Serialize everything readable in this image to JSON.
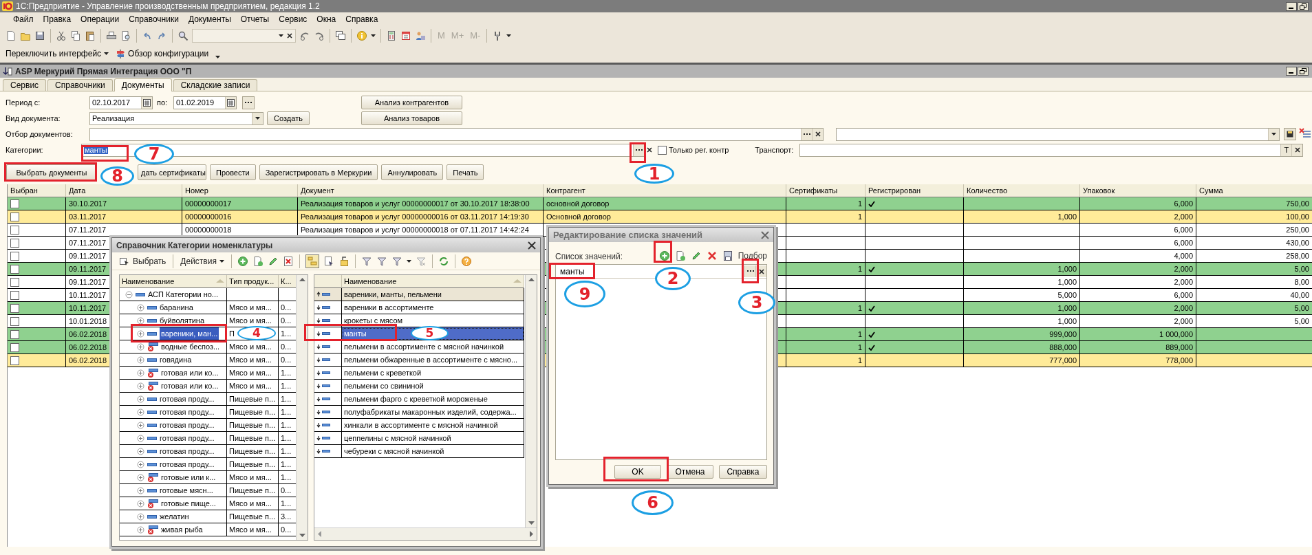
{
  "app": {
    "title": "1С:Предприятие - Управление производственным предприятием, редакция 1.2"
  },
  "menu": [
    "Файл",
    "Правка",
    "Операции",
    "Справочники",
    "Документы",
    "Отчеты",
    "Сервис",
    "Окна",
    "Справка"
  ],
  "toolbar": {
    "memory_buttons": [
      {
        "label": "M",
        "disabled": true
      },
      {
        "label": "M+",
        "disabled": true
      },
      {
        "label": "M-",
        "disabled": true
      }
    ]
  },
  "toolbar2": [
    {
      "label": "Переключить интерфейс",
      "kind": "dropdown"
    },
    {
      "label": "Обзор конфигурации",
      "kind": "link"
    }
  ],
  "document_window": {
    "title": "ASP Меркурий Прямая Интеграция ООО \"П",
    "tabs": [
      {
        "label": "Сервис",
        "selected": false
      },
      {
        "label": "Справочники",
        "selected": false
      },
      {
        "label": "Документы",
        "selected": true
      },
      {
        "label": "Складские записи",
        "selected": false
      }
    ],
    "period": {
      "label": "Период с:",
      "from": "02.10.2017",
      "to_label": "по:",
      "to": "01.02.2019"
    },
    "document_type": {
      "label": "Вид документа:",
      "value": "Реализация",
      "create_button": "Создать"
    },
    "analysis_buttons": [
      "Анализ контрагентов",
      "Анализ товаров"
    ],
    "document_filter": {
      "label": "Отбор документов:"
    },
    "categories": {
      "label": "Категории:",
      "value": "манты",
      "value_highlighted": true
    },
    "registered_only": {
      "label": "Только рег. контр",
      "checked": false
    },
    "transport": {
      "label": "Транспорт:",
      "type_button": "T"
    },
    "actions": [
      "Выбрать документы",
      "дать сертификаты",
      "Провести",
      "Зарегистрировать в Меркурии",
      "Аннулировать",
      "Печать"
    ],
    "table": {
      "columns": [
        "Выбран",
        "Дата",
        "Номер",
        "Документ",
        "Контрагент",
        "Сертификаты",
        "Регистрирован",
        "Количество",
        "Упаковок",
        "Сумма"
      ],
      "rows": [
        {
          "checked": false,
          "date": "30.10.2017",
          "number": "00000000017",
          "document": "Реализация товаров и услуг 00000000017 от 30.10.2017 18:38:00",
          "counterparty": "основной договор",
          "certificates": "1",
          "registered": true,
          "packages": "6,000",
          "sum": "750,00",
          "color": "#8fd18f"
        },
        {
          "checked": false,
          "date": "03.11.2017",
          "number": "00000000016",
          "document": "Реализация товаров и услуг 00000000016 от 03.11.2017 14:19:30",
          "counterparty": "Основной договор",
          "certificates": "1",
          "registered": false,
          "quantity": "1,000",
          "packages": "2,000",
          "sum": "100,00",
          "color": "#ffeb99"
        },
        {
          "checked": false,
          "date": "07.11.2017",
          "number": "00000000018",
          "document": "Реализация товаров и услуг 00000000018 от 07.11.2017 14:42:24",
          "registered": false,
          "packages": "6,000",
          "sum": "250,00",
          "color": "#ffffff"
        },
        {
          "checked": false,
          "date": "07.11.2017",
          "registered": false,
          "packages": "6,000",
          "sum": "430,00",
          "color": "#ffffff"
        },
        {
          "checked": false,
          "date": "09.11.2017",
          "registered": false,
          "packages": "4,000",
          "sum": "258,00",
          "color": "#ffffff"
        },
        {
          "checked": false,
          "date": "09.11.2017",
          "certificates": "1",
          "registered": true,
          "quantity": "1,000",
          "packages": "2,000",
          "sum": "5,00",
          "color": "#8fd18f"
        },
        {
          "checked": false,
          "date": "09.11.2017",
          "registered": false,
          "quantity": "1,000",
          "packages": "2,000",
          "sum": "8,00",
          "color": "#ffffff"
        },
        {
          "checked": false,
          "date": "10.11.2017",
          "registered": false,
          "quantity": "5,000",
          "packages": "6,000",
          "sum": "40,00",
          "color": "#ffffff"
        },
        {
          "checked": false,
          "date": "10.11.2017",
          "certificates": "1",
          "registered": true,
          "quantity": "1,000",
          "packages": "2,000",
          "sum": "5,00",
          "color": "#8fd18f"
        },
        {
          "checked": false,
          "date": "10.01.2018",
          "registered": false,
          "quantity": "1,000",
          "packages": "2,000",
          "sum": "5,00",
          "color": "#ffffff"
        },
        {
          "checked": false,
          "date": "06.02.2018",
          "certificates": "1",
          "registered": true,
          "quantity": "999,000",
          "packages": "1 000,000",
          "color": "#8fd18f"
        },
        {
          "checked": false,
          "date": "06.02.2018",
          "certificates": "1",
          "registered": true,
          "quantity": "888,000",
          "packages": "889,000",
          "color": "#8fd18f"
        },
        {
          "checked": false,
          "date": "06.02.2018",
          "certificates": "1",
          "registered": false,
          "quantity": "777,000",
          "packages": "778,000",
          "color": "#ffeb99"
        }
      ]
    }
  },
  "catalog_dialog": {
    "title": "Справочник Категории номенклатуры",
    "toolbar": [
      "Выбрать",
      "Действия"
    ],
    "tree": {
      "columns": [
        "Наименование",
        "Тип продук...",
        "К..."
      ],
      "items": [
        {
          "name": "АСП Категории но...",
          "expanded": true,
          "selected": false,
          "children": [
            {
              "name": "баранина",
              "type": "Мясо и мя...",
              "column_3": "0...",
              "deleted": false,
              "expanded": false,
              "selected": false
            },
            {
              "name": "буйволятина",
              "type": "Мясо и мя...",
              "column_3": "0...",
              "deleted": false,
              "expanded": false,
              "selected": false
            },
            {
              "name": "вареники, ман...",
              "type": "П",
              "column_3": "1...",
              "deleted": false,
              "expanded": false,
              "selected": true
            },
            {
              "name": "водные беспоз...",
              "type": "Мясо и мя...",
              "column_3": "0...",
              "deleted": true,
              "expanded": false,
              "selected": false
            },
            {
              "name": "говядина",
              "type": "Мясо и мя...",
              "column_3": "0...",
              "deleted": false,
              "expanded": false,
              "selected": false
            },
            {
              "name": "готовая или ко...",
              "type": "Мясо и мя...",
              "column_3": "1...",
              "deleted": true,
              "expanded": false,
              "selected": false
            },
            {
              "name": "готовая или ко...",
              "type": "Мясо и мя...",
              "column_3": "1...",
              "deleted": true,
              "expanded": false,
              "selected": false
            },
            {
              "name": "готовая проду...",
              "type": "Пищевые п...",
              "column_3": "1...",
              "deleted": false,
              "expanded": false,
              "selected": false
            },
            {
              "name": "готовая проду...",
              "type": "Пищевые п...",
              "column_3": "1...",
              "deleted": false,
              "expanded": false,
              "selected": false
            },
            {
              "name": "готовая проду...",
              "type": "Пищевые п...",
              "column_3": "1...",
              "deleted": false,
              "expanded": false,
              "selected": false
            },
            {
              "name": "готовая проду...",
              "type": "Пищевые п...",
              "column_3": "1...",
              "deleted": false,
              "expanded": false,
              "selected": false
            },
            {
              "name": "готовая проду...",
              "type": "Пищевые п...",
              "column_3": "1...",
              "deleted": false,
              "expanded": false,
              "selected": false
            },
            {
              "name": "готовая проду...",
              "type": "Пищевые п...",
              "column_3": "1...",
              "deleted": false,
              "expanded": false,
              "selected": false
            },
            {
              "name": "готовые или к...",
              "type": "Мясо и мя...",
              "column_3": "1...",
              "deleted": true,
              "expanded": false,
              "selected": false
            },
            {
              "name": "готовые мясн...",
              "type": "Пищевые п...",
              "column_3": "0...",
              "deleted": false,
              "expanded": false,
              "selected": false
            },
            {
              "name": "готовые пище...",
              "type": "Мясо и мя...",
              "column_3": "1...",
              "deleted": true,
              "expanded": false,
              "selected": false
            },
            {
              "name": "желатин",
              "type": "Пищевые п...",
              "column_3": "3...",
              "deleted": false,
              "expanded": false,
              "selected": false
            },
            {
              "name": "живая рыба",
              "type": "Мясо и мя...",
              "column_3": "0...",
              "deleted": true,
              "expanded": false,
              "selected": false
            }
          ]
        }
      ]
    },
    "list": {
      "column": "Наименование",
      "rows": [
        {
          "name": "вареники, манты, пельмени",
          "kind": "parent",
          "selected": false
        },
        {
          "name": "вареники в ассортименте",
          "kind": "item",
          "selected": false
        },
        {
          "name": "крокеты с мясом",
          "kind": "item",
          "selected": false
        },
        {
          "name": "манты",
          "kind": "item",
          "selected": true
        },
        {
          "name": "пельмени в ассортименте с мясной начинкой",
          "kind": "item",
          "selected": false
        },
        {
          "name": "пельмени обжаренные в ассортименте с мясно...",
          "kind": "item",
          "selected": false
        },
        {
          "name": "пельмени с креветкой",
          "kind": "item",
          "selected": false
        },
        {
          "name": "пельмени со свининой",
          "kind": "item",
          "selected": false
        },
        {
          "name": "пельмени фарго с креветкой мороженые",
          "kind": "item",
          "selected": false
        },
        {
          "name": "полуфабрикаты макаронных изделий, содержа...",
          "kind": "item",
          "selected": false
        },
        {
          "name": "хинкали в ассортименте с мясной начинкой",
          "kind": "item",
          "selected": false
        },
        {
          "name": "цеппелины с мясной начинкой",
          "kind": "item",
          "selected": false
        },
        {
          "name": "чебуреки с мясной начинкой",
          "kind": "item",
          "selected": false
        }
      ]
    }
  },
  "list_dialog": {
    "title": "Редактирование списка значений",
    "list_label": "Список значений:",
    "pick_label": "Подбор",
    "values": [
      {
        "value": "манты"
      }
    ],
    "buttons": [
      "OK",
      "Отмена",
      "Справка"
    ]
  },
  "annotations": [
    {
      "number": "1"
    },
    {
      "number": "2"
    },
    {
      "number": "3"
    },
    {
      "number": "4"
    },
    {
      "number": "5"
    },
    {
      "number": "6"
    },
    {
      "number": "7"
    },
    {
      "number": "8"
    },
    {
      "number": "9"
    }
  ]
}
